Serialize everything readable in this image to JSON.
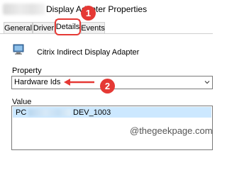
{
  "window": {
    "title": "Display Adapter Properties"
  },
  "tabs": [
    {
      "label": "General",
      "active": false
    },
    {
      "label": "Driver",
      "active": false
    },
    {
      "label": "Details",
      "active": true
    },
    {
      "label": "Events",
      "active": false
    }
  ],
  "device": {
    "icon": "display-adapter-icon",
    "name": "Citrix Indirect Display Adapter"
  },
  "property": {
    "label": "Property",
    "selected": "Hardware Ids"
  },
  "value": {
    "label": "Value",
    "items": [
      {
        "prefix": "PC",
        "suffix": "DEV_1003"
      }
    ]
  },
  "annotations": {
    "step1": "1",
    "step2": "2",
    "color": "#e53935"
  },
  "watermark": "@thegeekpage.com"
}
